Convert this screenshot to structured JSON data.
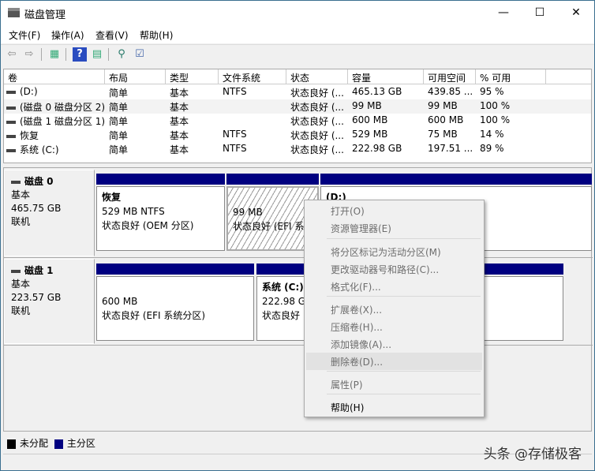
{
  "window": {
    "title": "磁盘管理",
    "minimize": "—",
    "maximize": "☐",
    "close": "✕"
  },
  "menu": [
    "文件(F)",
    "操作(A)",
    "查看(V)",
    "帮助(H)"
  ],
  "toolbar": {
    "icons": [
      "back-arrow-icon",
      "forward-arrow-icon",
      "console-tree-icon",
      "help-icon",
      "action-pane-icon",
      "connect-icon",
      "properties-icon"
    ],
    "glyphs": [
      "⇦",
      "⇨",
      "▦",
      "?",
      "▤",
      "⚲",
      "☑"
    ]
  },
  "table": {
    "headers": [
      "卷",
      "布局",
      "类型",
      "文件系统",
      "状态",
      "容量",
      "可用空间",
      "% 可用"
    ],
    "rows": [
      [
        "(D:)",
        "简单",
        "基本",
        "NTFS",
        "状态良好 (...",
        "465.13 GB",
        "439.85 ...",
        "95 %"
      ],
      [
        "(磁盘 0 磁盘分区 2)",
        "简单",
        "基本",
        "",
        "状态良好 (...",
        "99 MB",
        "99 MB",
        "100 %"
      ],
      [
        "(磁盘 1 磁盘分区 1)",
        "简单",
        "基本",
        "",
        "状态良好 (...",
        "600 MB",
        "600 MB",
        "100 %"
      ],
      [
        "恢复",
        "简单",
        "基本",
        "NTFS",
        "状态良好 (...",
        "529 MB",
        "75 MB",
        "14 %"
      ],
      [
        "系统 (C:)",
        "简单",
        "基本",
        "NTFS",
        "状态良好 (...",
        "222.98 GB",
        "197.51 ...",
        "89 %"
      ]
    ]
  },
  "disks": [
    {
      "name": "磁盘 0",
      "type": "基本",
      "size": "465.75 GB",
      "status": "联机",
      "partitions": [
        {
          "name": "恢复",
          "size": "529 MB NTFS",
          "status": "状态良好 (OEM 分区)"
        },
        {
          "name": "",
          "size": "99 MB",
          "status": "状态良好 (EFI 系"
        },
        {
          "name": "(D:)",
          "size": "",
          "status": ""
        }
      ]
    },
    {
      "name": "磁盘 1",
      "type": "基本",
      "size": "223.57 GB",
      "status": "联机",
      "partitions": [
        {
          "name": "",
          "size": "600 MB",
          "status": "状态良好 (EFI 系统分区)"
        },
        {
          "name": "系统  (C:)",
          "size": "222.98 G",
          "status": "状态良好"
        }
      ]
    }
  ],
  "context_menu": [
    {
      "label": "打开(O)",
      "enabled": false
    },
    {
      "label": "资源管理器(E)",
      "enabled": false
    },
    {
      "label": "将分区标记为活动分区(M)",
      "enabled": false
    },
    {
      "label": "更改驱动器号和路径(C)...",
      "enabled": false
    },
    {
      "label": "格式化(F)...",
      "enabled": false
    },
    {
      "label": "扩展卷(X)...",
      "enabled": false
    },
    {
      "label": "压缩卷(H)...",
      "enabled": false
    },
    {
      "label": "添加镜像(A)...",
      "enabled": false
    },
    {
      "label": "删除卷(D)...",
      "enabled": false,
      "highlighted": true
    },
    {
      "label": "属性(P)",
      "enabled": false
    },
    {
      "label": "帮助(H)",
      "enabled": true
    }
  ],
  "legend": [
    {
      "label": "未分配",
      "color": "#000000"
    },
    {
      "label": "主分区",
      "color": "#000080"
    }
  ],
  "watermark": "头条 @存储极客"
}
